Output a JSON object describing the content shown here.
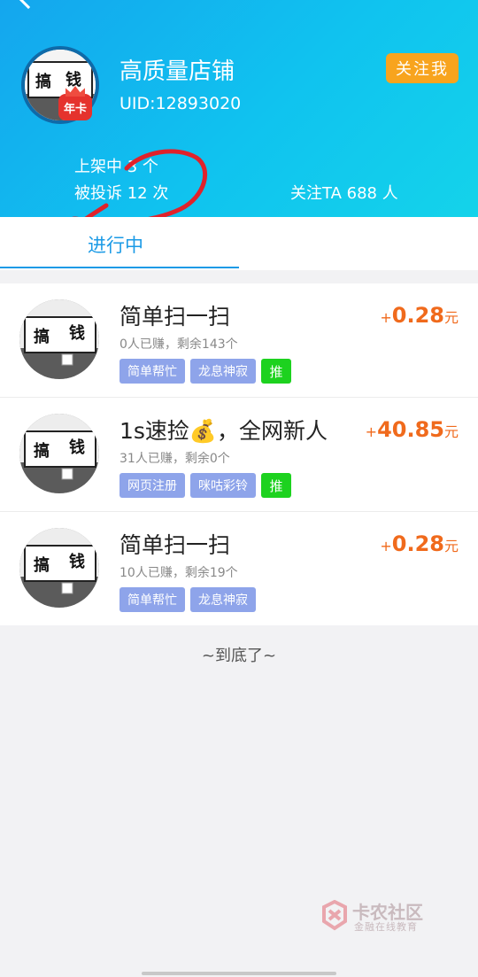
{
  "header": {
    "title_partial": "",
    "shop": {
      "name": "高质量店铺",
      "uid": "UID:12893020",
      "badge": "年卡",
      "follow_label": "关注我"
    },
    "stats": {
      "listed": "上架中 3 个",
      "complaints": "被投诉 12 次",
      "followers": "关注TA 688 人"
    }
  },
  "tabs": [
    {
      "label": "进行中",
      "active": true
    }
  ],
  "tasks": [
    {
      "title": "简单扫一扫",
      "reward_sign": "+",
      "reward_amount": "0.28",
      "reward_unit": "元",
      "meta": "0人已赚，剩余143个",
      "tags": [
        "简单帮忙",
        "龙息神寂"
      ],
      "push": "推"
    },
    {
      "title": "1s速捡💰，全网新人",
      "reward_sign": "+",
      "reward_amount": "40.85",
      "reward_unit": "元",
      "meta": "31人已赚，剩余0个",
      "tags": [
        "网页注册",
        "咪咕彩铃"
      ],
      "push": "推"
    },
    {
      "title": "简单扫一扫",
      "reward_sign": "+",
      "reward_amount": "0.28",
      "reward_unit": "元",
      "meta": "10人已赚，剩余19个",
      "tags": [
        "简单帮忙",
        "龙息神寂"
      ],
      "push": ""
    }
  ],
  "footer": {
    "end_text": "~到底了~"
  },
  "watermark": {
    "title": "卡农社区",
    "subtitle": "金融在线教育"
  },
  "colors": {
    "header_gradient_start": "#14a6ee",
    "header_gradient_end": "#14d3ea",
    "follow_button": "#f8a41e",
    "active_tab": "#1a9ae6",
    "reward": "#f06a1c",
    "tag": "#8ea4ea",
    "push_tag": "#1dd21f",
    "annotation_scribble": "#e0222b"
  },
  "icons": {
    "back": "chevron-left-icon",
    "avatar": "calligraphy-plaque-avatar",
    "badge": "crown-badge-icon"
  }
}
